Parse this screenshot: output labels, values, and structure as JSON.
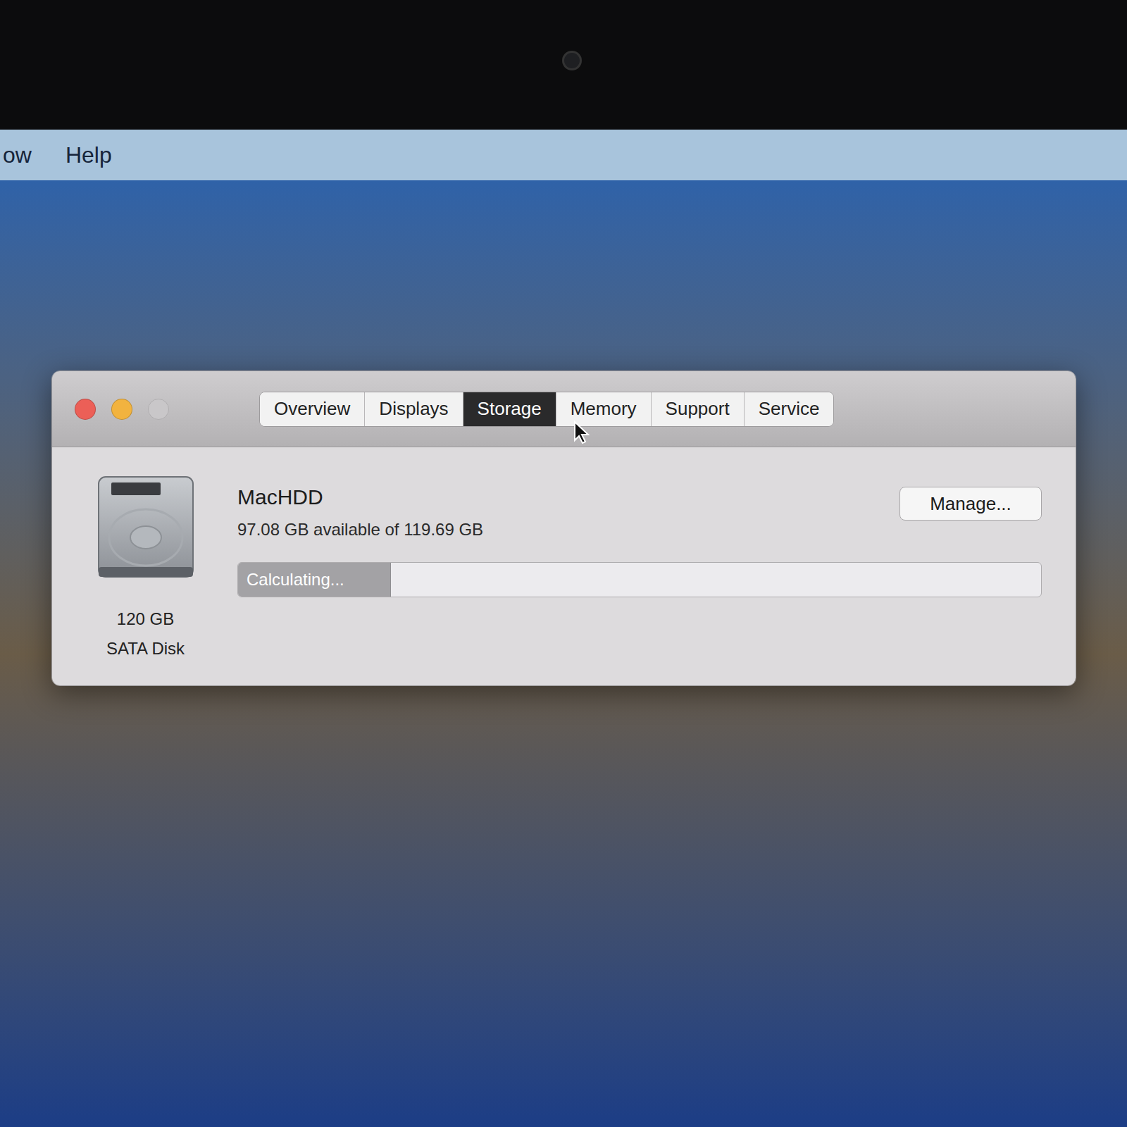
{
  "menu_bar": {
    "items": [
      "ow",
      "Help"
    ]
  },
  "window": {
    "controls": [
      {
        "name": "close",
        "color": "#ec5f57",
        "disabled": false
      },
      {
        "name": "minimize",
        "color": "#f2b33f",
        "disabled": false
      },
      {
        "name": "zoom",
        "color": "#c9c7c9",
        "disabled": true
      }
    ]
  },
  "tabs": [
    {
      "label": "Overview",
      "selected": false
    },
    {
      "label": "Displays",
      "selected": false
    },
    {
      "label": "Storage",
      "selected": true
    },
    {
      "label": "Memory",
      "selected": false
    },
    {
      "label": "Support",
      "selected": false
    },
    {
      "label": "Service",
      "selected": false
    }
  ],
  "disk": {
    "name": "MacHDD",
    "availability": "97.08 GB available of 119.69 GB",
    "capacity": "120 GB",
    "type": "SATA Disk",
    "bar": {
      "label": "Calculating...",
      "level": 0.19
    }
  },
  "buttons": [
    "Manage..."
  ]
}
